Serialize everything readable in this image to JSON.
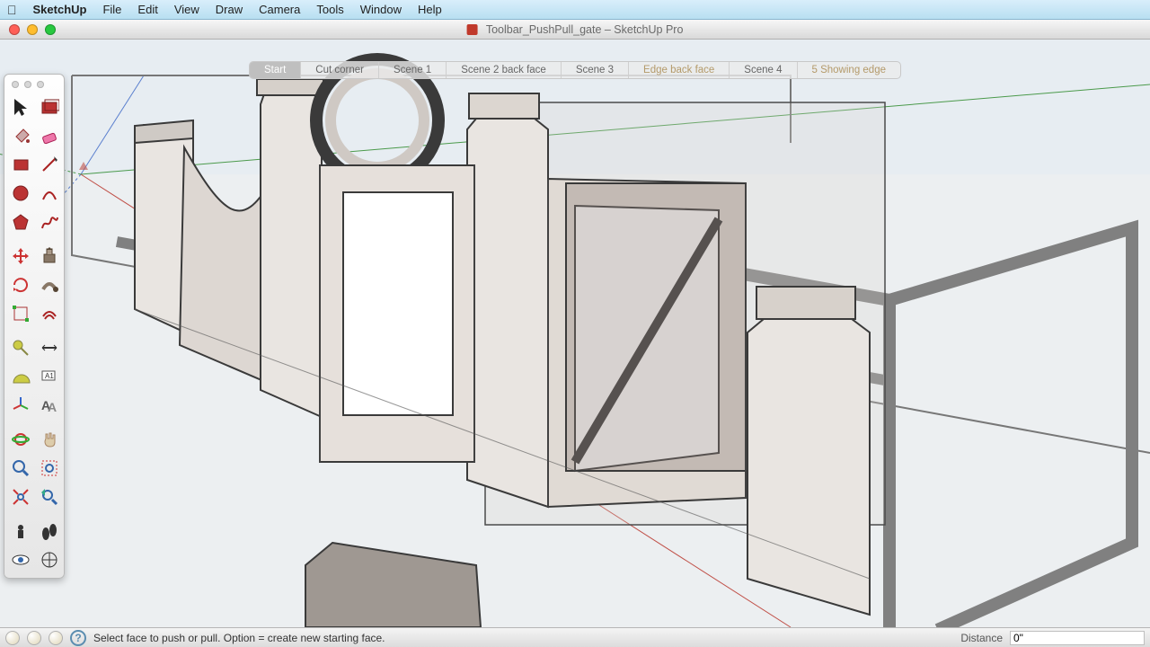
{
  "menubar": {
    "appname": "SketchUp",
    "items": [
      "File",
      "Edit",
      "View",
      "Draw",
      "Camera",
      "Tools",
      "Window",
      "Help"
    ]
  },
  "window": {
    "title": "Toolbar_PushPull_gate – SketchUp Pro"
  },
  "scenes": {
    "tabs": [
      {
        "label": "Start",
        "cls": "start"
      },
      {
        "label": "Cut corner",
        "cls": ""
      },
      {
        "label": "Scene 1",
        "cls": ""
      },
      {
        "label": "Scene 2 back face",
        "cls": ""
      },
      {
        "label": "Scene 3",
        "cls": ""
      },
      {
        "label": "Edge back face",
        "cls": "edge"
      },
      {
        "label": "Scene 4",
        "cls": ""
      },
      {
        "label": "5 Showing edge",
        "cls": "edge"
      }
    ]
  },
  "status": {
    "hint": "Select face to push or pull.  Option = create new starting face.",
    "vcb_label": "Distance",
    "vcb_value": "0\""
  },
  "tools": {
    "col": [
      [
        "select-tool",
        "Select"
      ],
      [
        "make-component-tool",
        "Make Component"
      ],
      [
        "paint-bucket-tool",
        "Paint Bucket"
      ],
      [
        "eraser-tool",
        "Eraser"
      ],
      [
        "rectangle-tool",
        "Rectangle"
      ],
      [
        "line-tool",
        "Line"
      ],
      [
        "circle-tool",
        "Circle"
      ],
      [
        "arc-tool",
        "Arc"
      ],
      [
        "polygon-tool",
        "Polygon"
      ],
      [
        "freehand-tool",
        "Freehand"
      ],
      [
        "move-tool",
        "Move"
      ],
      [
        "push-pull-tool",
        "Push/Pull"
      ],
      [
        "rotate-tool",
        "Rotate"
      ],
      [
        "follow-me-tool",
        "Follow Me"
      ],
      [
        "scale-tool",
        "Scale"
      ],
      [
        "offset-tool",
        "Offset"
      ],
      [
        "tape-measure-tool",
        "Tape Measure"
      ],
      [
        "dimension-tool",
        "Dimension"
      ],
      [
        "protractor-tool",
        "Protractor"
      ],
      [
        "text-tool",
        "Text"
      ],
      [
        "axes-tool",
        "Axes"
      ],
      [
        "3d-text-tool",
        "3D Text"
      ],
      [
        "orbit-tool",
        "Orbit"
      ],
      [
        "pan-tool",
        "Pan"
      ],
      [
        "zoom-tool",
        "Zoom"
      ],
      [
        "zoom-window-tool",
        "Zoom Window"
      ],
      [
        "zoom-extents-tool",
        "Zoom Extents"
      ],
      [
        "previous-view-tool",
        "Previous"
      ],
      [
        "position-camera-tool",
        "Position Camera"
      ],
      [
        "walk-tool",
        "Walk"
      ],
      [
        "look-around-tool",
        "Look Around"
      ],
      [
        "section-plane-tool",
        "Section Plane"
      ]
    ]
  },
  "colors": {
    "axis_red": "#c05048",
    "axis_green": "#4b9a4b",
    "axis_blue": "#5a7fce",
    "face_front": "#f6f4f2",
    "face_back": "#c9c0bc",
    "xray_line": "#6e6863"
  }
}
